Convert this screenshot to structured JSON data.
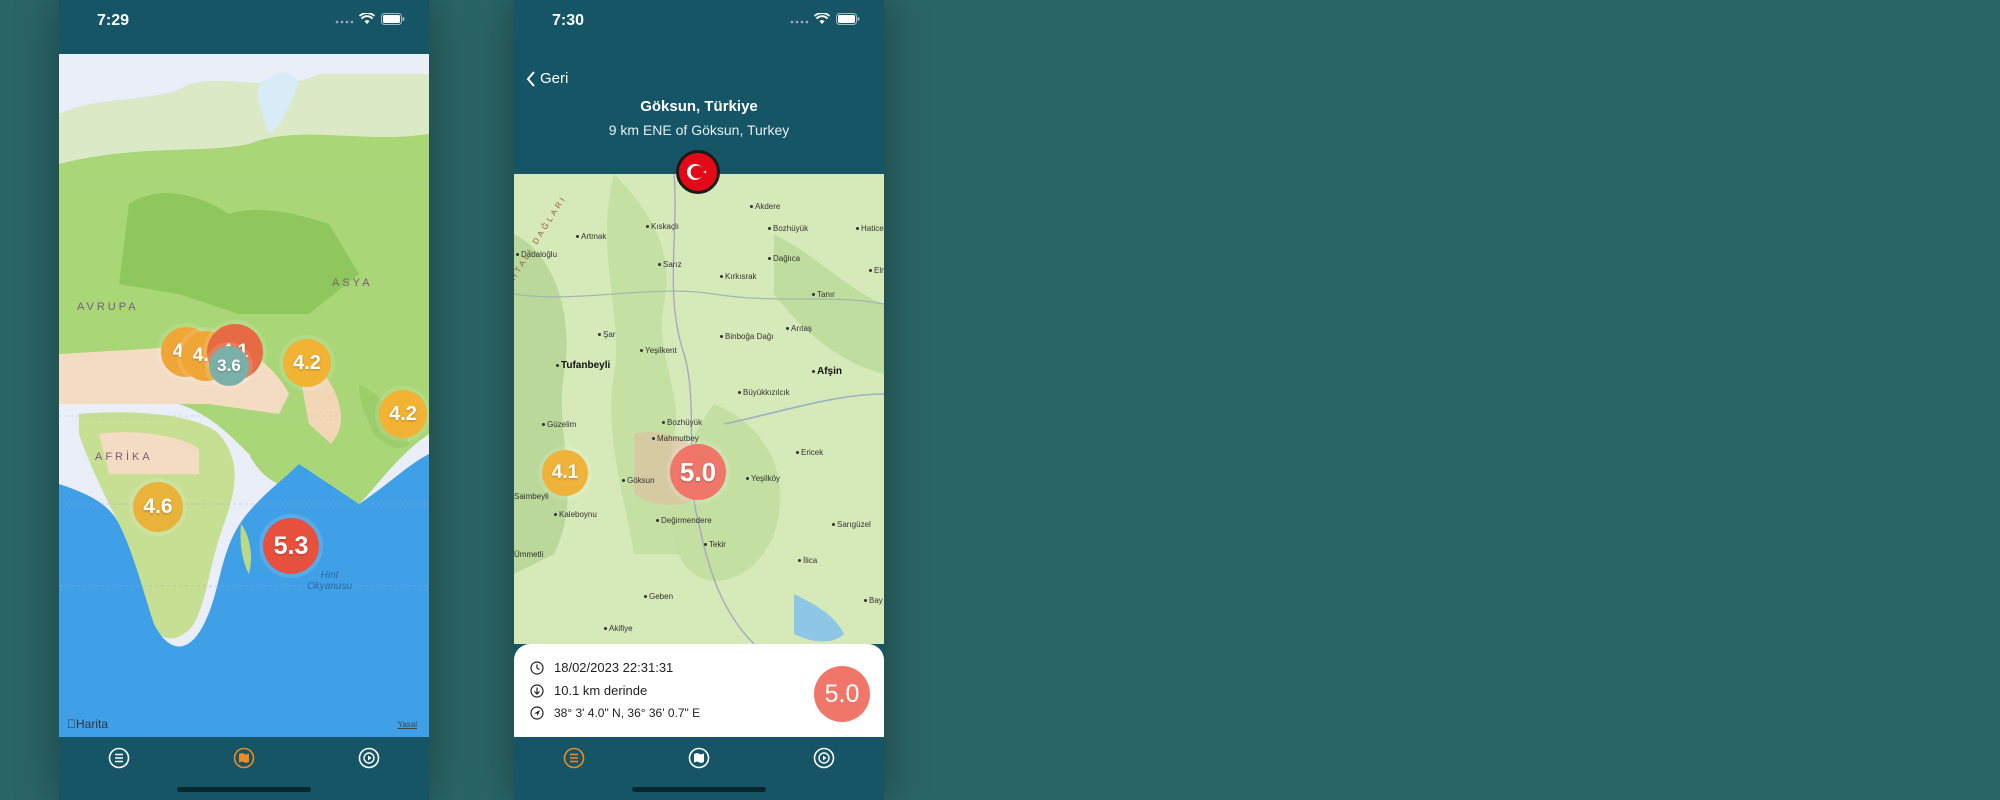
{
  "screen1": {
    "status": {
      "time": "7:29"
    },
    "map": {
      "region_labels": {
        "europe": "AVRUPA",
        "asia": "ASYA",
        "africa": "AFRİKA"
      },
      "ocean_label_line1": "Hint",
      "ocean_label_line2": "Okyanusu",
      "credit": "Harita",
      "legal": "Yasal",
      "clusters": [
        {
          "value": "4.1",
          "color": "#e66a43"
        },
        {
          "value": "4.7",
          "color": "#f0a637"
        },
        {
          "value": "4.7",
          "color": "#f0a637"
        },
        {
          "value": "3.6",
          "color": "#7ab0a8"
        },
        {
          "value": "4.2",
          "color": "#f2b233"
        },
        {
          "value": "4.2",
          "color": "#f2b233"
        },
        {
          "value": "4.6",
          "color": "#e9b23a"
        },
        {
          "value": "5.3",
          "color": "#e8503e"
        }
      ]
    },
    "tabs": {
      "active": "map",
      "icons": [
        "list-icon",
        "map-icon",
        "settings-icon"
      ],
      "active_color": "#f08a24"
    }
  },
  "screen2": {
    "status": {
      "time": "7:30"
    },
    "back_label": "Geri",
    "title": "Göksun, Türkiye",
    "subtitle": "9 km ENE of Göksun, Turkey",
    "map": {
      "range_label": "AHTALI DAĞLARI",
      "towns": [
        "Akdere",
        "Bozhüyük",
        "Hatice",
        "Artmak",
        "Kıskaçlı",
        "Dadaloğlu",
        "Sarız",
        "Dağlıca",
        "Kırkısrak",
        "Elm",
        "Tanır",
        "Şar",
        "Binboğa Dağı",
        "Arıtaş",
        "Yeşilkent",
        "Tufanbeyli",
        "Afşin",
        "Büyükkızılcık",
        "Güzelim",
        "Bozhüyük",
        "Mahmutbey",
        "Ericek",
        "Göksun",
        "Yeşilköy",
        "Saimbeyli",
        "Kaleboynu",
        "Değirmendere",
        "Sarıgüzel",
        "Tekir",
        "İlica",
        "Ümmetli",
        "Geben",
        "Bay",
        "Akifiye"
      ],
      "markers": [
        {
          "value": "4.1",
          "color": "#f0b33a"
        },
        {
          "value": "5.0",
          "color": "#f0766a"
        }
      ]
    },
    "info": {
      "datetime": "18/02/2023 22:31:31",
      "depth": "10.1 km  derinde",
      "coords": "38° 3' 4.0\" N, 36° 36' 0.7\" E",
      "magnitude": "5.0"
    },
    "tabs": {
      "active": "list",
      "icons": [
        "list-icon",
        "map-icon",
        "settings-icon"
      ],
      "active_color": "#f08a24"
    }
  }
}
